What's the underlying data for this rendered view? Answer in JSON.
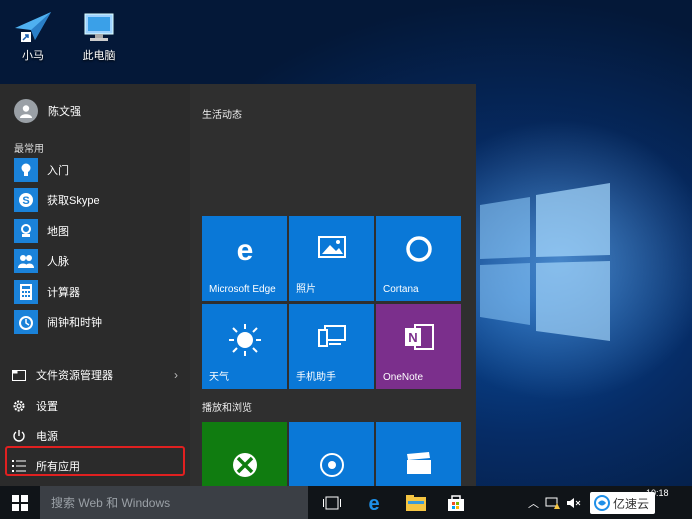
{
  "desktop": {
    "icons": [
      {
        "label": "小马",
        "icon": "paper-plane-shortcut-icon"
      },
      {
        "label": "此电脑",
        "icon": "computer-icon"
      }
    ]
  },
  "start_menu": {
    "user_name": "陈文强",
    "most_used_title": "最常用",
    "apps": [
      {
        "label": "入门",
        "icon": "lightbulb-icon"
      },
      {
        "label": "获取Skype",
        "icon": "skype-icon"
      },
      {
        "label": "地图",
        "icon": "maps-icon"
      },
      {
        "label": "人脉",
        "icon": "people-icon"
      },
      {
        "label": "计算器",
        "icon": "calculator-icon"
      },
      {
        "label": "闹钟和时钟",
        "icon": "alarm-clock-icon"
      }
    ],
    "system_items": [
      {
        "label": "文件资源管理器",
        "icon": "file-explorer-icon",
        "chevron": "›"
      },
      {
        "label": "设置",
        "icon": "gear-icon"
      },
      {
        "label": "电源",
        "icon": "power-icon"
      },
      {
        "label": "所有应用",
        "icon": "all-apps-list-icon"
      }
    ],
    "groups": [
      {
        "title": "生活动态"
      },
      {
        "title": "播放和浏览"
      }
    ],
    "tiles": [
      {
        "label": "Microsoft Edge",
        "icon": "edge-icon",
        "color": "#0a78d7"
      },
      {
        "label": "照片",
        "icon": "photos-icon",
        "color": "#0a78d7"
      },
      {
        "label": "Cortana",
        "icon": "cortana-icon",
        "color": "#0a78d7"
      },
      {
        "label": "天气",
        "icon": "weather-sun-icon",
        "color": "#0a78d7"
      },
      {
        "label": "手机助手",
        "icon": "phone-companion-icon",
        "color": "#0a78d7"
      },
      {
        "label": "OneNote",
        "icon": "onenote-icon",
        "color": "#7b2f8c"
      },
      {
        "label": "",
        "icon": "xbox-icon",
        "color": "#107c10"
      },
      {
        "label": "",
        "icon": "groove-music-icon",
        "color": "#0a78d7"
      },
      {
        "label": "",
        "icon": "movies-tv-icon",
        "color": "#0a78d7"
      }
    ]
  },
  "taskbar": {
    "search_placeholder": "搜索 Web 和 Windows",
    "clock_time": "10:18",
    "watermark_text": "亿速云"
  },
  "colors": {
    "accent": "#0a78d7",
    "onenote": "#7b2f8c",
    "xbox": "#107c10",
    "highlight": "#e02020",
    "menu_bg": "#2b2b2b",
    "taskbar_bg": "#101418"
  }
}
